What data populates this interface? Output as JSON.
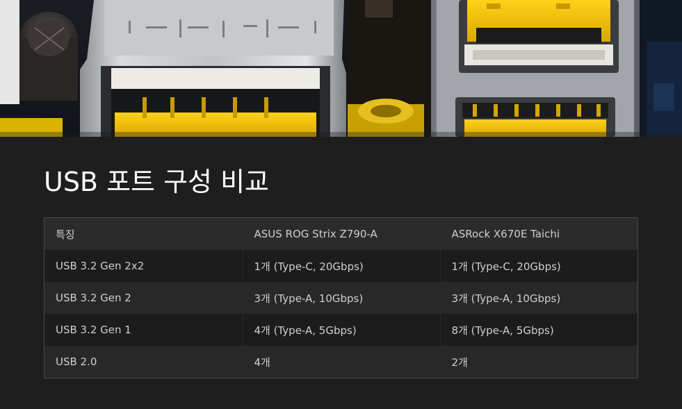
{
  "hero": {
    "image_icon": "usb-ports-photo"
  },
  "section": {
    "title": "USB 포트 구성 비교"
  },
  "table": {
    "headers": [
      "특징",
      "ASUS ROG Strix Z790-A",
      "ASRock X670E Taichi"
    ],
    "rows": [
      [
        "USB 3.2 Gen 2x2",
        "1개 (Type-C, 20Gbps)",
        "1개 (Type-C, 20Gbps)"
      ],
      [
        "USB 3.2 Gen 2",
        "3개 (Type-A, 10Gbps)",
        "3개 (Type-A, 10Gbps)"
      ],
      [
        "USB 3.2 Gen 1",
        "4개 (Type-A, 5Gbps)",
        "8개 (Type-A, 5Gbps)"
      ],
      [
        "USB 2.0",
        "4개",
        "2개"
      ]
    ]
  },
  "colors": {
    "background": "#1e1e1e",
    "title": "#ffffff",
    "header_row": "#2b2b2b",
    "row_odd": "#1c1c1c",
    "row_even": "#282828",
    "cell_text": "#cfcfcf",
    "usb_insert": "#f0c000"
  }
}
